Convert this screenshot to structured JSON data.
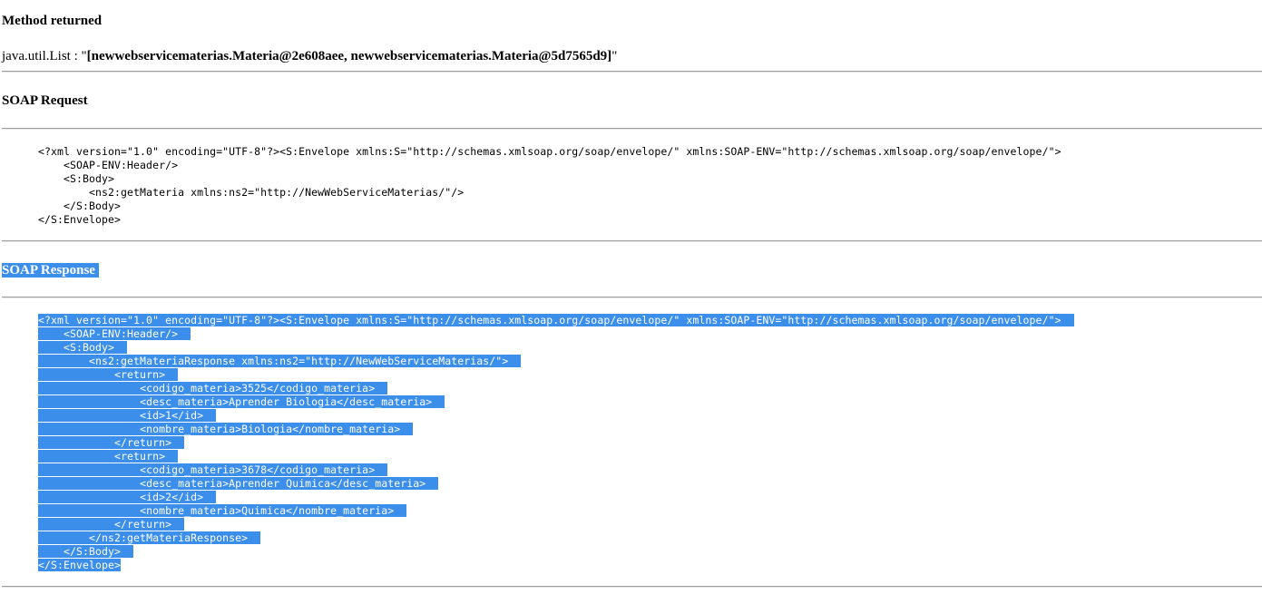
{
  "method_returned": {
    "heading": "Method returned",
    "type_prefix": "java.util.List : \"",
    "value": "[newwebservicematerias.Materia@2e608aee, newwebservicematerias.Materia@5d7565d9]",
    "suffix": "\""
  },
  "soap_request": {
    "heading": "SOAP Request",
    "lines": [
      "<?xml version=\"1.0\" encoding=\"UTF-8\"?><S:Envelope xmlns:S=\"http://schemas.xmlsoap.org/soap/envelope/\" xmlns:SOAP-ENV=\"http://schemas.xmlsoap.org/soap/envelope/\">",
      "    <SOAP-ENV:Header/>",
      "    <S:Body>",
      "        <ns2:getMateria xmlns:ns2=\"http://NewWebServiceMaterias/\"/>",
      "    </S:Body>",
      "</S:Envelope>"
    ]
  },
  "soap_response": {
    "heading": "SOAP Response",
    "selection_color": "#3b8eea",
    "lines": [
      "<?xml version=\"1.0\" encoding=\"UTF-8\"?><S:Envelope xmlns:S=\"http://schemas.xmlsoap.org/soap/envelope/\" xmlns:SOAP-ENV=\"http://schemas.xmlsoap.org/soap/envelope/\">",
      "    <SOAP-ENV:Header/>",
      "    <S:Body>",
      "        <ns2:getMateriaResponse xmlns:ns2=\"http://NewWebServiceMaterias/\">",
      "            <return>",
      "                <codigo_materia>3525</codigo_materia>",
      "                <desc_materia>Aprender Biologia</desc_materia>",
      "                <id>1</id>",
      "                <nombre_materia>Biologia</nombre_materia>",
      "            </return>",
      "            <return>",
      "                <codigo_materia>3678</codigo_materia>",
      "                <desc_materia>Aprender Quimica</desc_materia>",
      "                <id>2</id>",
      "                <nombre_materia>Quimica</nombre_materia>",
      "            </return>",
      "        </ns2:getMateriaResponse>",
      "    </S:Body>",
      "</S:Envelope>"
    ]
  }
}
